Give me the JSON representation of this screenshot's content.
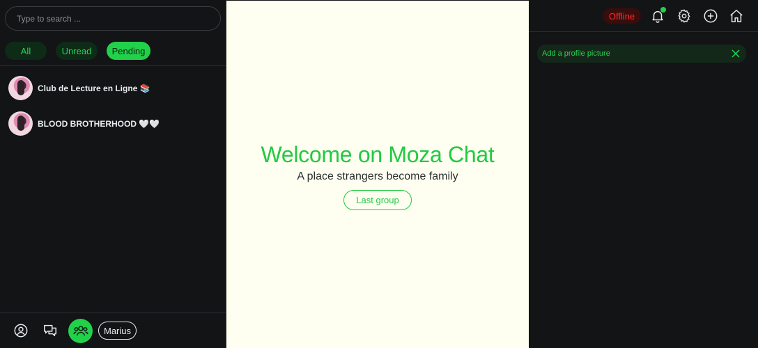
{
  "search": {
    "placeholder": "Type to search ..."
  },
  "filters": {
    "all": "All",
    "unread": "Unread",
    "pending": "Pending"
  },
  "conversations": [
    {
      "name": "Club de Lecture en Ligne 📚"
    },
    {
      "name": "BLOOD BROTHERHOOD 🤍🤍"
    }
  ],
  "bottom": {
    "user_label": "Marius"
  },
  "center": {
    "title": "Welcome on Moza Chat",
    "subtitle": "A place strangers become family",
    "button": "Last group"
  },
  "topbar": {
    "status": "Offline"
  },
  "banner": {
    "text": "Add a profile picture"
  },
  "colors": {
    "accent": "#22d14a",
    "offline": "#ff2a2a",
    "background": "#121416",
    "center_bg": "#fefff0"
  },
  "icons": [
    "bell-icon",
    "gear-icon",
    "plus-circle-icon",
    "home-icon",
    "profile-icon",
    "chat-icon",
    "group-icon",
    "close-icon"
  ]
}
